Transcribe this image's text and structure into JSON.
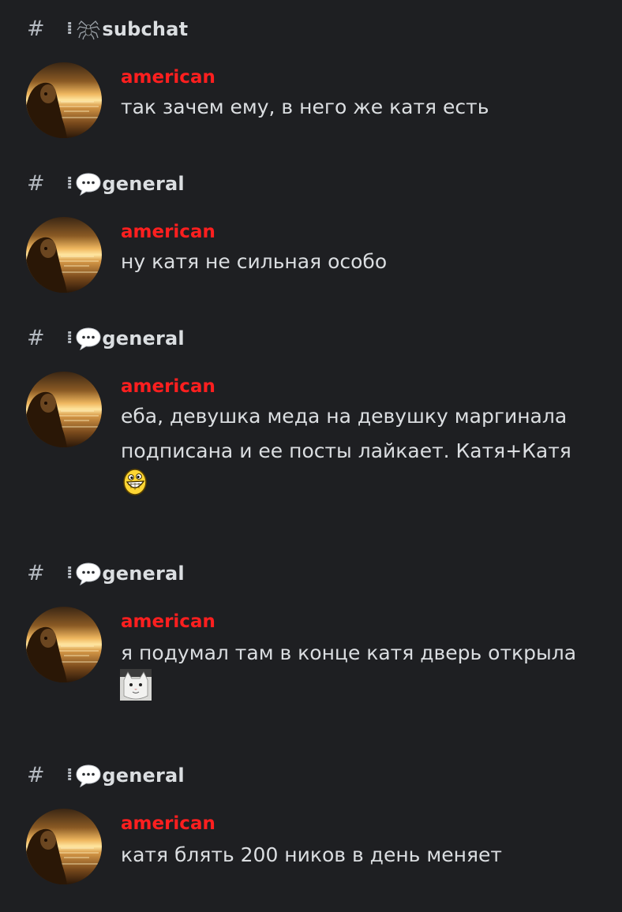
{
  "results": [
    {
      "channel": {
        "name": "subchat",
        "icon": "spider-icon"
      },
      "author": "american",
      "lines": [
        "так зачем ему, в него же катя есть"
      ]
    },
    {
      "channel": {
        "name": "general",
        "icon": "speech-bubble-icon"
      },
      "author": "american",
      "lines": [
        "ну катя не сильная особо"
      ]
    },
    {
      "channel": {
        "name": "general",
        "icon": "speech-bubble-icon"
      },
      "author": "american",
      "lines": [
        "еба, девушка меда на девушку маргинала",
        "подписана и ее посты лайкает. Катя+Катя"
      ],
      "emoji": "grinning-face-emoji"
    },
    {
      "channel": {
        "name": "general",
        "icon": "speech-bubble-icon"
      },
      "author": "american",
      "lines": [
        "я подумал там в конце катя дверь открыла"
      ],
      "emoji": "cat-face-emoji"
    },
    {
      "channel": {
        "name": "general",
        "icon": "speech-bubble-icon"
      },
      "author": "american",
      "lines": [
        "катя блять 200 ников в день меняет"
      ]
    }
  ],
  "colors": {
    "background": "#1e1f22",
    "author": "#ff1f1f",
    "text": "#dbdee1",
    "muted": "#b5bac1"
  }
}
